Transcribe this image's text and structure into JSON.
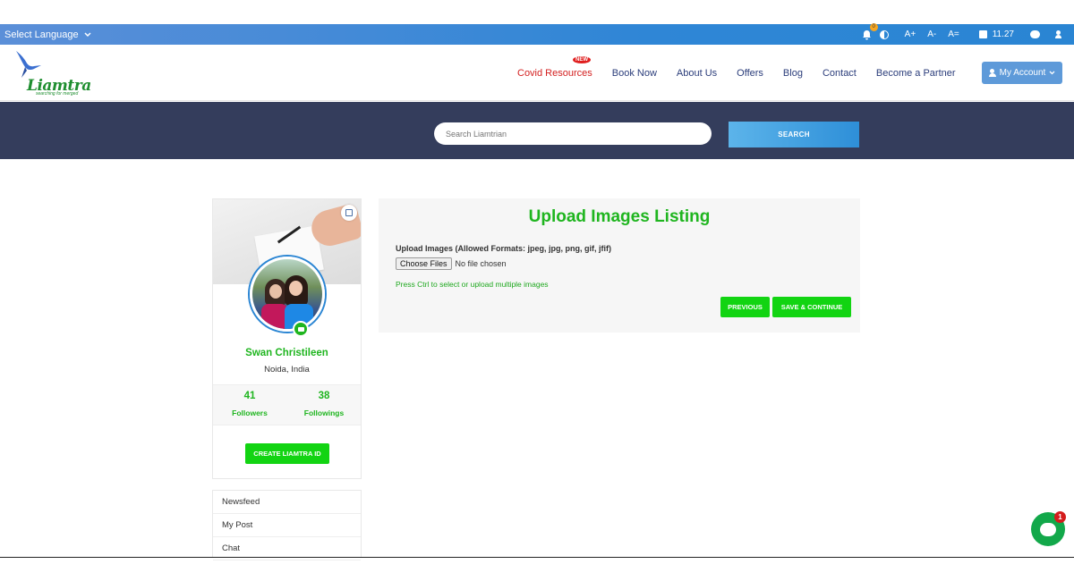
{
  "topbar": {
    "language_label": "Select Language",
    "bell_count": "0",
    "font_increase": "A+",
    "font_decrease": "A-",
    "font_reset": "A=",
    "time": "11.27"
  },
  "nav": {
    "logo_text": "Liamtra",
    "logo_tagline": "searching for merged",
    "new_badge": "NEW",
    "links": [
      "Covid Resources",
      "Book Now",
      "About Us",
      "Offers",
      "Blog",
      "Contact",
      "Become a Partner"
    ],
    "account_label": "My Account"
  },
  "search": {
    "placeholder": "Search Liamtrian",
    "button_label": "SEARCH"
  },
  "profile": {
    "name": "Swan Christileen",
    "location": "Noida, India",
    "followers_count": "41",
    "followers_label": "Followers",
    "followings_count": "38",
    "followings_label": "Followings",
    "create_button": "CREATE LIAMTRA ID"
  },
  "menu": {
    "items": [
      "Newsfeed",
      "My Post",
      "Chat"
    ]
  },
  "upload": {
    "title": "Upload Images Listing",
    "label": "Upload Images (Allowed Formats: jpeg, jpg, png, gif, jfif)",
    "choose_button": "Choose Files",
    "no_file": "No file chosen",
    "hint": "Press Ctrl to select or upload multiple images",
    "previous_button": "PREVIOUS",
    "save_button": "SAVE & CONTINUE"
  },
  "chat_widget": {
    "badge": "1"
  },
  "colors": {
    "accent_green": "#12d412",
    "brand_blue": "#2a85d3",
    "search_band": "#343d5c",
    "covid_red": "#d32020"
  }
}
